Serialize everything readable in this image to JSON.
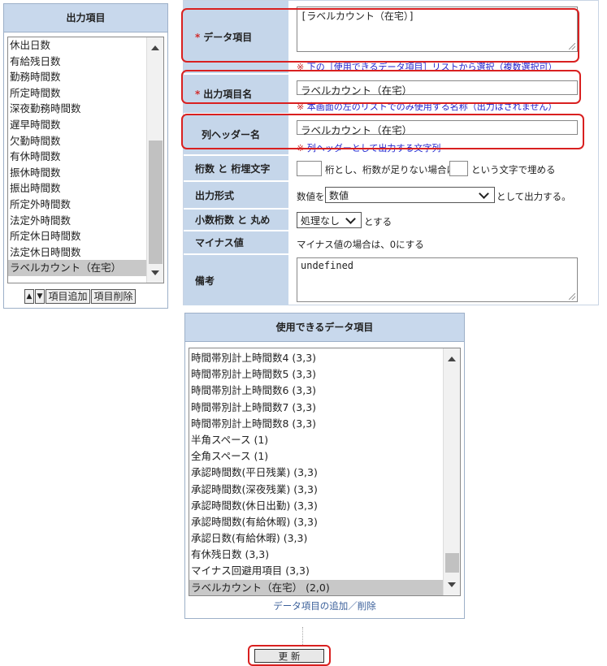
{
  "left_panel": {
    "title": "出力項目",
    "items": [
      "休出日数",
      "有給残日数",
      "勤務時間数",
      "所定時間数",
      "深夜勤務時間数",
      "遅早時間数",
      "欠勤時間数",
      "有休時間数",
      "振休時間数",
      "振出時間数",
      "所定外時間数",
      "法定外時間数",
      "所定休日時間数",
      "法定休日時間数",
      "ラベルカウント（在宅）"
    ],
    "selected_index": 14,
    "up_label": "▲",
    "down_label": "▼",
    "add_label": "項目追加",
    "delete_label": "項目削除"
  },
  "form": {
    "data_item": {
      "label": "データ項目",
      "value": "[ラベルカウント（在宅）]",
      "note_mark": "※",
      "note": " 下の［使用できるデータ項目］リストから選択（複数選択可）"
    },
    "output_name": {
      "label": "出力項目名",
      "value": "ラベルカウント（在宅）",
      "note_mark": "※",
      "note": " 本画面の左のリストでのみ使用する名称（出力はされません）"
    },
    "column_header": {
      "label": "列ヘッダー名",
      "value": "ラベルカウント（在宅）",
      "note_mark": "※",
      "note": " 列ヘッダーとして出力する文字列"
    },
    "digits": {
      "label": "桁数 と 桁埋文字",
      "text1": "桁とし、桁数が足りない場合は",
      "text2": "という文字で埋める"
    },
    "format": {
      "label": "出力形式",
      "prefix": "数値を",
      "selected": "数値",
      "suffix": "として出力する。"
    },
    "decimal": {
      "label": "小数桁数 と 丸め",
      "selected": "処理なし",
      "suffix": "とする"
    },
    "minus": {
      "label": "マイナス値",
      "text": "マイナス値の場合は、0にする"
    },
    "remarks": {
      "label": "備考",
      "value": "undefined"
    }
  },
  "data_items_panel": {
    "title": "使用できるデータ項目",
    "items": [
      "時間帯別計上時間数4 (3,3)",
      "時間帯別計上時間数5 (3,3)",
      "時間帯別計上時間数6 (3,3)",
      "時間帯別計上時間数7 (3,3)",
      "時間帯別計上時間数8 (3,3)",
      "半角スペース (1)",
      "全角スペース (1)",
      "承認時間数(平日残業) (3,3)",
      "承認時間数(深夜残業) (3,3)",
      "承認時間数(休日出勤) (3,3)",
      "承認時間数(有給休暇) (3,3)",
      "承認日数(有給休暇) (3,3)",
      "有休残日数 (3,3)",
      "マイナス回避用項目 (3,3)",
      "ラベルカウント（在宅） (2,0)"
    ],
    "selected_index": 14,
    "link": "データ項目の追加／削除"
  },
  "update_button": "更 新",
  "colors": {
    "header_bg": "#c8d8ec",
    "label_bg": "#c5d6ea",
    "required": "#d12b2b",
    "note": "#2222cc",
    "highlight": "#d92020",
    "link": "#3a5f9a"
  }
}
